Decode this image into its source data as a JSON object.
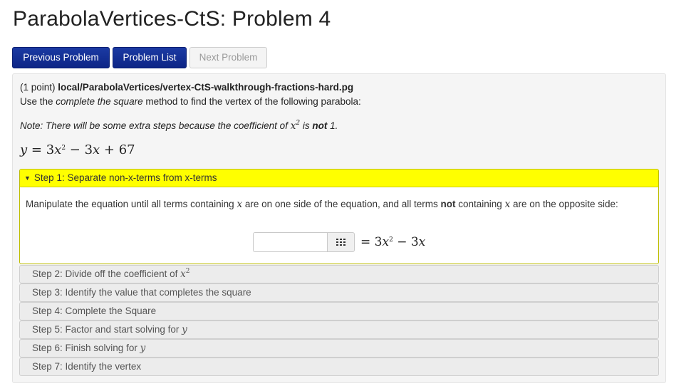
{
  "page": {
    "title": "ParabolaVertices-CtS: Problem 4"
  },
  "nav": {
    "previous": "Previous Problem",
    "list": "Problem List",
    "next": "Next Problem"
  },
  "problem": {
    "points": "(1 point)",
    "path": "local/ParabolaVertices/vertex-CtS-walkthrough-fractions-hard.pg",
    "instr_before": "Use the ",
    "instr_em": "complete the square",
    "instr_after": " method to find the vertex of the following parabola:",
    "note_before": "Note: There will be some extra steps because the coefficient of ",
    "note_var": "x",
    "note_exp": "2",
    "note_is": " is ",
    "note_bold": "not",
    "note_end": " 1.",
    "equation": {
      "lhs": "y",
      "eq": " = 3",
      "var": "x",
      "exp": "2",
      "mid": " − 3",
      "var2": "x",
      "tail": " + 67"
    }
  },
  "steps": {
    "step1": {
      "label": "Step 1: Separate non-x-terms from x-terms",
      "body_a": "Manipulate the equation until all terms containing ",
      "var": "x",
      "body_b": " are on one side of the equation, and all terms ",
      "bold": "not",
      "body_c": " containing ",
      "body_d": " are on the opposite side:",
      "input_value": "",
      "rhs_eq": "= 3",
      "rhs_var": "x",
      "rhs_exp": "2",
      "rhs_mid": " − 3",
      "rhs_var2": "x"
    },
    "step2": {
      "label": "Step 2: Divide off the coefficient of ",
      "var": "x",
      "exp": "2"
    },
    "step3": {
      "label": "Step 3: Identify the value that completes the square"
    },
    "step4": {
      "label": "Step 4: Complete the Square"
    },
    "step5": {
      "label": "Step 5: Factor and start solving for ",
      "var": "y"
    },
    "step6": {
      "label": "Step 6: Finish solving for ",
      "var": "y"
    },
    "step7": {
      "label": "Step 7: Identify the vertex"
    }
  },
  "icons": {
    "palette": "grid-icon",
    "caret": "caret-down-icon"
  },
  "colors": {
    "nav_primary": "#0d2586",
    "step_active": "#ffff00"
  }
}
